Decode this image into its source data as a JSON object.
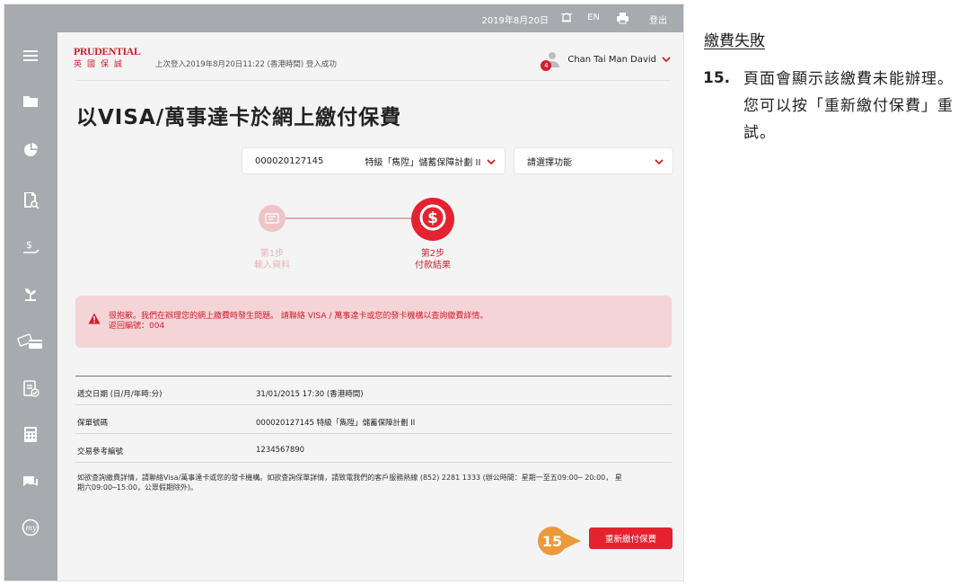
{
  "topbar": {
    "date": "2019年8月20日",
    "lang": "EN",
    "logout": "登出"
  },
  "header": {
    "logo_text": "PRUDENTIAL",
    "logo_cn": "英國保誠",
    "last_login": "上次登入2019年8月20日11:22 (香港時間) 登入成功",
    "user_name": "Chan Tai Man David",
    "notification_count": "4"
  },
  "page": {
    "title": "以VISA/萬事達卡於網上繳付保費"
  },
  "policy_select": {
    "number": "000020127145",
    "plan": "特級「雋陞」儲蓄保障計劃 II"
  },
  "function_select": {
    "value": "請選擇功能"
  },
  "stepper": {
    "step1_num": "第1步",
    "step1_name": "輸入資料",
    "step2_num": "第2步",
    "step2_name": "付款結果"
  },
  "error": {
    "line1": "很抱歉。我們在辦理您的網上繳費時發生問題。 請聯絡 VISA / 萬事達卡或您的發卡機構以查詢繳費詳情。",
    "line2": "返回編號：004"
  },
  "details": [
    {
      "key": "遞交日期 (日/月/年時:分)",
      "value": "31/01/2015 17:30 (香港時間)"
    },
    {
      "key": "保單號碼",
      "value": "000020127145 特級「雋陞」儲蓄保障計劃 II"
    },
    {
      "key": "交易參考編號",
      "value": "1234567890"
    }
  ],
  "footnote": {
    "line1": "如欲查詢繳費詳情，請聯絡Visa/萬事達卡或您的發卡機構。如欲查詢保單詳情，請致電我們的客戶服務熱線 (852) 2281 1333 (辦公時間：星期一至五09:00─ 20:00， 星",
    "line2": "期六09:00─15:00，公眾假期除外)。"
  },
  "callout_number": "15",
  "retry_label": "重新繳付保費",
  "aside": {
    "heading": "繳費失敗",
    "step_number": "15.",
    "step_text": "頁面會顯示該繳費未能辦理。您可以按「重新繳付保費」重試。"
  },
  "colors": {
    "accent": "#e5222f",
    "sidebar": "#a7aaae",
    "error_bg": "#f4d4d7",
    "callout": "#eb9a3b"
  },
  "sidebar_icons": [
    "menu-icon",
    "folder-icon",
    "pie-chart-icon",
    "document-search-icon",
    "dollar-hand-icon",
    "plant-icon",
    "payment-card-icon",
    "clipboard-check-icon",
    "calculator-icon",
    "chat-icon",
    "my-icon"
  ]
}
